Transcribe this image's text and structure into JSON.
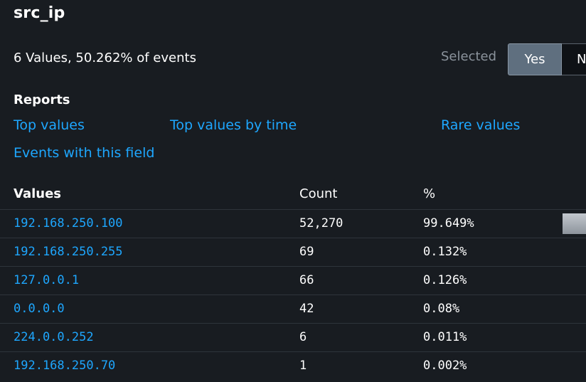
{
  "field": {
    "title": "src_ip",
    "summary": "6 Values, 50.262% of events"
  },
  "selected": {
    "label": "Selected",
    "yes_label": "Yes",
    "no_label": "No",
    "value": "Yes"
  },
  "reports": {
    "heading": "Reports",
    "links": {
      "top_values": "Top values",
      "top_values_by_time": "Top values by time",
      "rare_values": "Rare values",
      "events_with_field": "Events with this field"
    }
  },
  "table": {
    "headers": {
      "values": "Values",
      "count": "Count",
      "percent": "%"
    },
    "rows": [
      {
        "value": "192.168.250.100",
        "count": "52,270",
        "percent": "99.649%",
        "fraction": 0.99649
      },
      {
        "value": "192.168.250.255",
        "count": "69",
        "percent": "0.132%",
        "fraction": 0.00132
      },
      {
        "value": "127.0.0.1",
        "count": "66",
        "percent": "0.126%",
        "fraction": 0.00126
      },
      {
        "value": "0.0.0.0",
        "count": "42",
        "percent": "0.08%",
        "fraction": 0.0008
      },
      {
        "value": "224.0.0.252",
        "count": "6",
        "percent": "0.011%",
        "fraction": 0.00011
      },
      {
        "value": "192.168.250.70",
        "count": "1",
        "percent": "0.002%",
        "fraction": 2e-05
      }
    ]
  },
  "colors": {
    "background": "#181c21",
    "link": "#1ea7ff",
    "toggle_selected": "#5f6f7f",
    "muted_text": "#8b939c"
  }
}
